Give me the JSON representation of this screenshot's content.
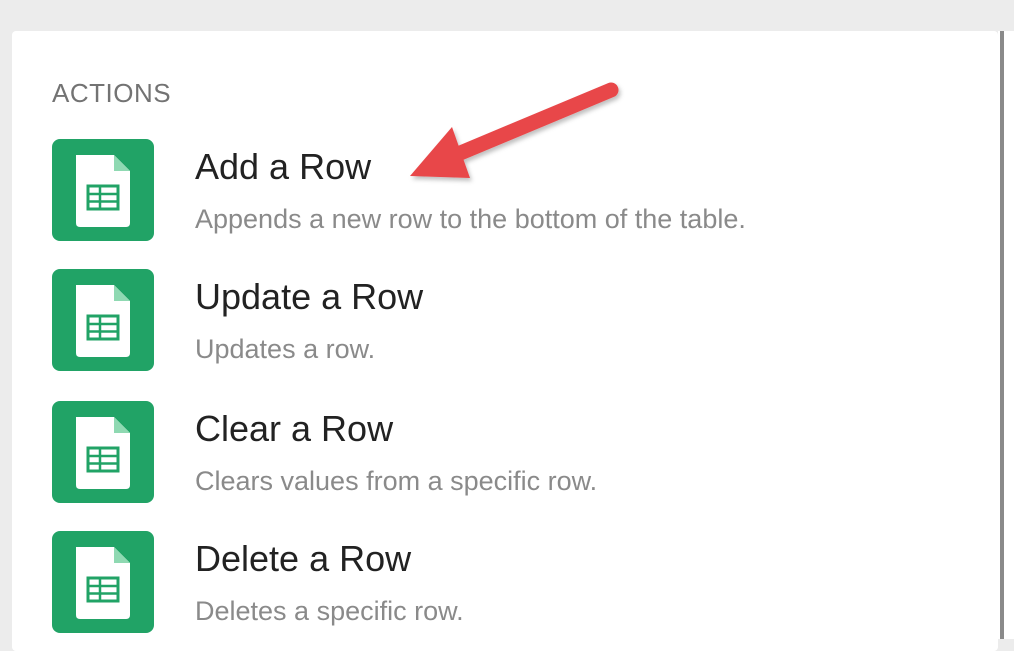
{
  "section": {
    "title": "ACTIONS"
  },
  "actions": [
    {
      "title": "Add a Row",
      "description": "Appends a new row to the bottom of the table.",
      "icon": "google-sheets-icon"
    },
    {
      "title": "Update a Row",
      "description": "Updates a row.",
      "icon": "google-sheets-icon"
    },
    {
      "title": "Clear a Row",
      "description": "Clears values from a specific row.",
      "icon": "google-sheets-icon"
    },
    {
      "title": "Delete a Row",
      "description": "Deletes a specific row.",
      "icon": "google-sheets-icon"
    }
  ],
  "colors": {
    "icon_background": "#21a366",
    "annotation_arrow": "#e8474a"
  }
}
